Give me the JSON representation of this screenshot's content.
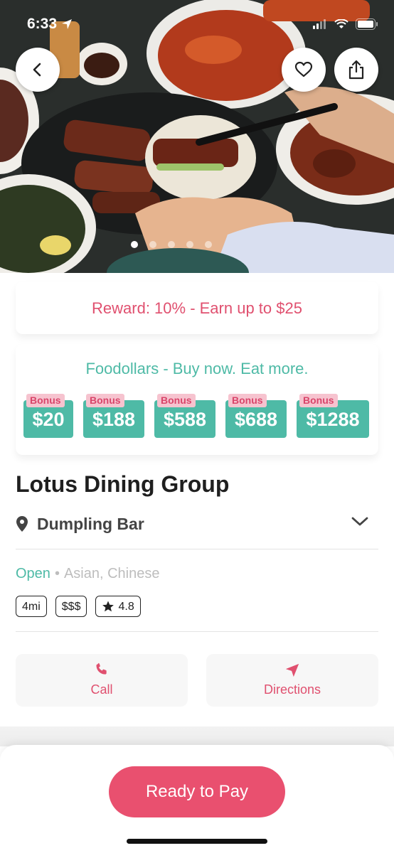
{
  "status_bar": {
    "time": "6:33"
  },
  "hero": {
    "carousel_page": 1,
    "carousel_count": 5
  },
  "reward": {
    "text": "Reward: 10% - Earn up to $25"
  },
  "foodollars": {
    "title": "Foodollars - Buy now. Eat more.",
    "items": [
      {
        "tag": "Bonus",
        "amount": "$20"
      },
      {
        "tag": "Bonus",
        "amount": "$188"
      },
      {
        "tag": "Bonus",
        "amount": "$588"
      },
      {
        "tag": "Bonus",
        "amount": "$688"
      },
      {
        "tag": "Bonus",
        "amount": "$1288"
      }
    ]
  },
  "restaurant": {
    "name": "Lotus Dining Group",
    "location": "Dumpling Bar",
    "status": "Open",
    "separator": "•",
    "cuisine": "Asian, Chinese",
    "chips": {
      "distance": "4mi",
      "price": "$$$",
      "rating": "4.8"
    }
  },
  "actions": {
    "call_label": "Call",
    "directions_label": "Directions"
  },
  "footer": {
    "pay_label": "Ready to Pay"
  },
  "colors": {
    "accent_pink": "#e9506f",
    "teal": "#4ebaa6",
    "tag_pink": "#f6c3cf"
  }
}
